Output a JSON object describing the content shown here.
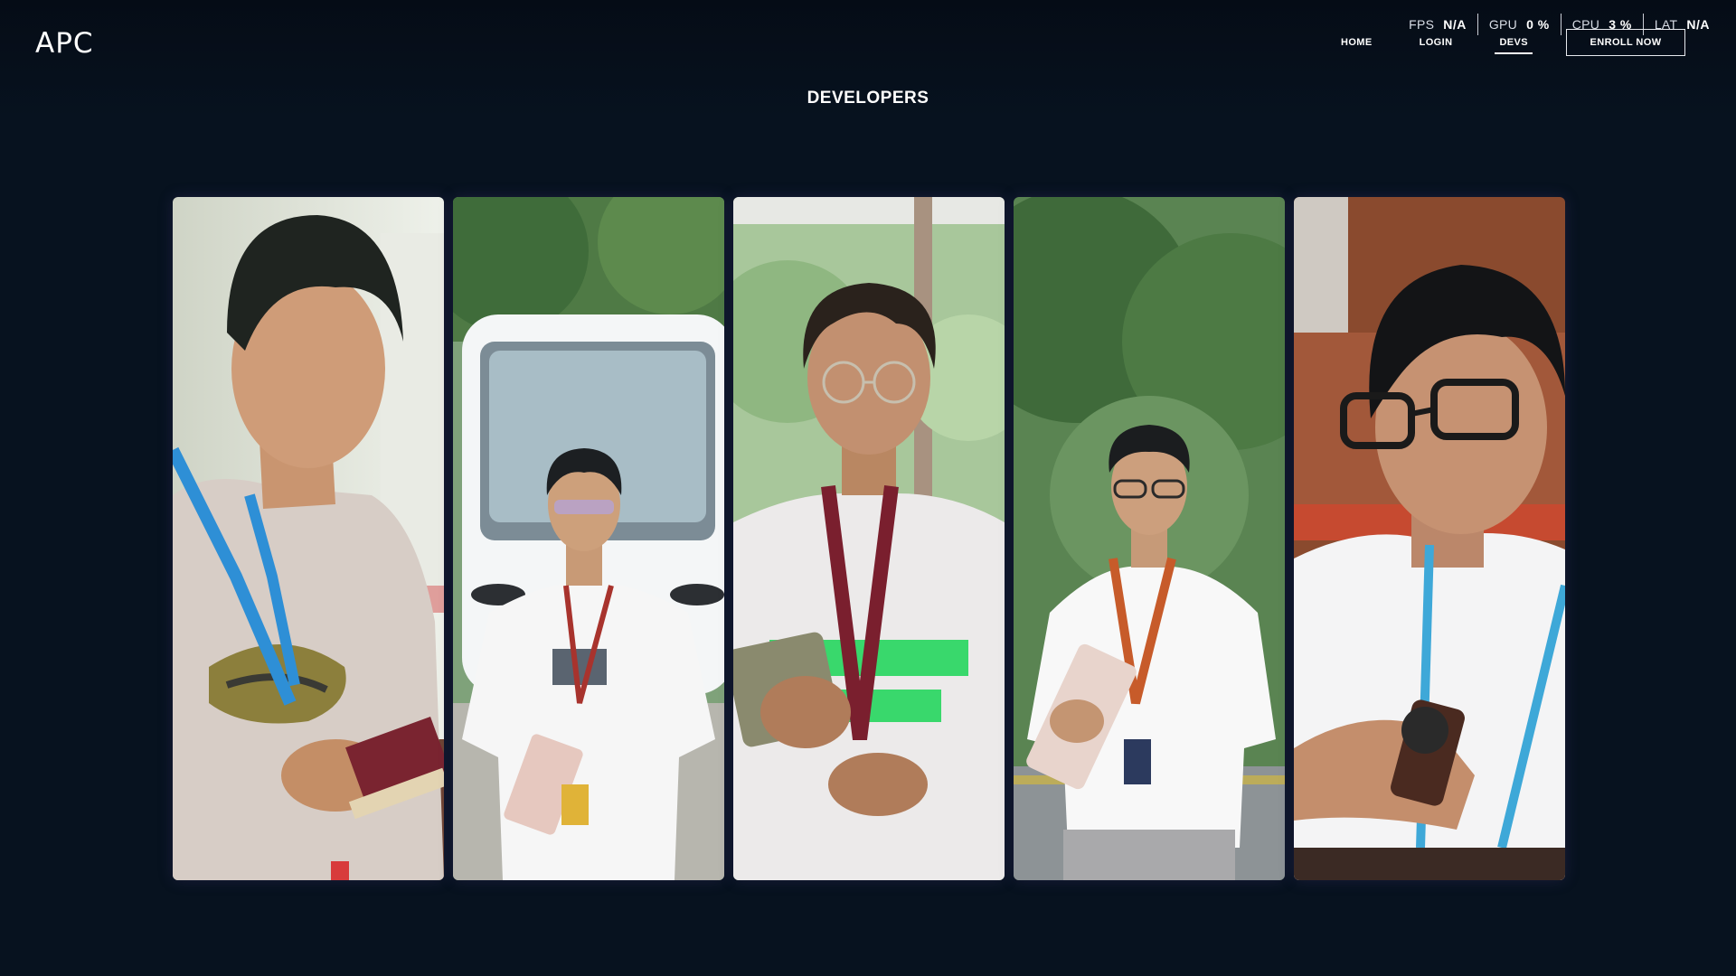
{
  "brand": {
    "logo": "APC"
  },
  "perf": [
    {
      "label": "FPS",
      "value": "N/A"
    },
    {
      "label": "GPU",
      "value": "0 %"
    },
    {
      "label": "CPU",
      "value": "3 %"
    },
    {
      "label": "LAT",
      "value": "N/A"
    }
  ],
  "nav": {
    "home": "HOME",
    "login": "LOGIN",
    "devs": "DEVS",
    "enroll": "ENROLL NOW",
    "active": "DEVS"
  },
  "page": {
    "title": "DEVELOPERS"
  },
  "developers": [
    {
      "photo": "developer-photo-1"
    },
    {
      "photo": "developer-photo-2"
    },
    {
      "photo": "developer-photo-3"
    },
    {
      "photo": "developer-photo-4"
    },
    {
      "photo": "developer-photo-5"
    }
  ],
  "colors": {
    "background": "#07121f",
    "text": "#ffffff",
    "lanyard_blue": "#2e8fd6",
    "lanyard_maroon": "#7a1f2e"
  }
}
